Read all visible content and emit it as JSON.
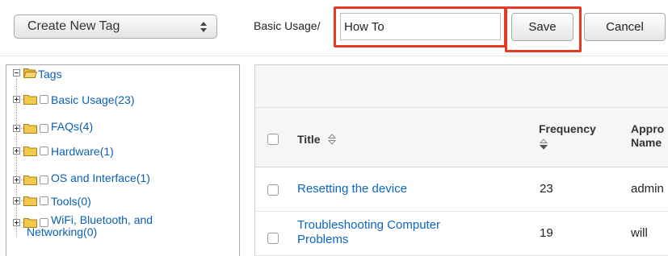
{
  "toolbar": {
    "action_select": {
      "selected": "Create New Tag"
    },
    "parent_path": "Basic Usage/",
    "tag_name_input": {
      "value": "How To"
    },
    "save_label": "Save",
    "cancel_label": "Cancel",
    "highlight_color": "#e53a26"
  },
  "tree": {
    "root": {
      "label": "Tags",
      "icon": "folder-open-icon"
    },
    "items": [
      {
        "label": "Basic Usage(23)"
      },
      {
        "label": "FAQs(4)"
      },
      {
        "label": "Hardware(1)"
      },
      {
        "label": "OS and Interface(1)"
      },
      {
        "label": "Tools(0)"
      },
      {
        "label_line1": "WiFi, Bluetooth, and",
        "label_line2": "Networking(0)"
      }
    ]
  },
  "grid": {
    "columns": {
      "title": "Title",
      "frequency": "Frequency",
      "approver_line1": "Appro",
      "approver_line2": "Name"
    },
    "rows": [
      {
        "title": "Resetting the device",
        "frequency": "23",
        "approver": "admin"
      },
      {
        "title_line1": "Troubleshooting Computer",
        "title_line2": "Problems",
        "frequency": "19",
        "approver": "will"
      }
    ]
  },
  "colors": {
    "link": "#0b66c3",
    "tree_link": "#0b5fb0",
    "folder": "#f2c94c",
    "highlight": "#e53a26"
  }
}
